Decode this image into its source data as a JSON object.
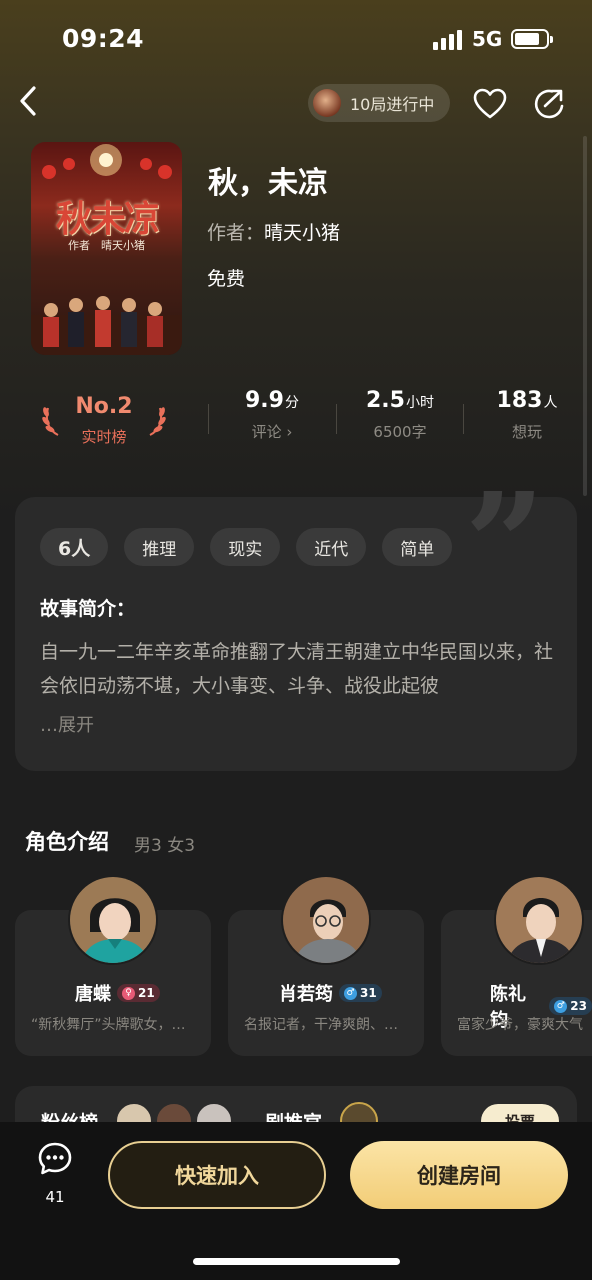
{
  "status_bar": {
    "time": "09:24",
    "network": "5G"
  },
  "header": {
    "progress_label": "10局进行中"
  },
  "book": {
    "title": "秋，未凉",
    "author_label": "作者：",
    "author_name": "晴天小猪",
    "price": "免费",
    "cover_title": "秋未凉",
    "cover_author": "作者　晴天小猪"
  },
  "stats": {
    "rank_no": "No.2",
    "rank_label": "实时榜",
    "score_value": "9.9",
    "score_unit": "分",
    "score_sub": "评论 ›",
    "duration_value": "2.5",
    "duration_unit": "小时",
    "duration_sub": "6500字",
    "players_value": "183",
    "players_unit": "人",
    "players_sub": "想玩"
  },
  "intro": {
    "tags": [
      "6人",
      "推理",
      "现实",
      "近代",
      "简单"
    ],
    "heading": "故事简介：",
    "text": "自一九一二年辛亥革命推翻了大清王朝建立中华民国以来，社会依旧动荡不堪，大小事变、斗争、战役此起彼",
    "expand": "…展开"
  },
  "roles": {
    "heading": "角色介绍",
    "summary": "男3 女3",
    "items": [
      {
        "name": "唐蝶",
        "gender": "female",
        "gender_symbol": "♀",
        "age": "21",
        "desc": "“新秋舞厅”头牌歌女，…"
      },
      {
        "name": "肖若筠",
        "gender": "male",
        "gender_symbol": "♂",
        "age": "31",
        "desc": "名报记者，干净爽朗、…"
      },
      {
        "name": "陈礼钧",
        "gender": "male",
        "gender_symbol": "♂",
        "age": "23",
        "desc": "富家少爷，豪爽大气"
      }
    ]
  },
  "fans": {
    "title": "粉丝榜",
    "title2": "剧推官",
    "vote_label": "投票"
  },
  "bottom": {
    "chat_count": "41",
    "join_label": "快速加入",
    "create_label": "创建房间"
  },
  "colors": {
    "accent_gold": "#f2cd77",
    "rank_red": "#f08a6f",
    "card_bg": "#2a2a2a"
  }
}
